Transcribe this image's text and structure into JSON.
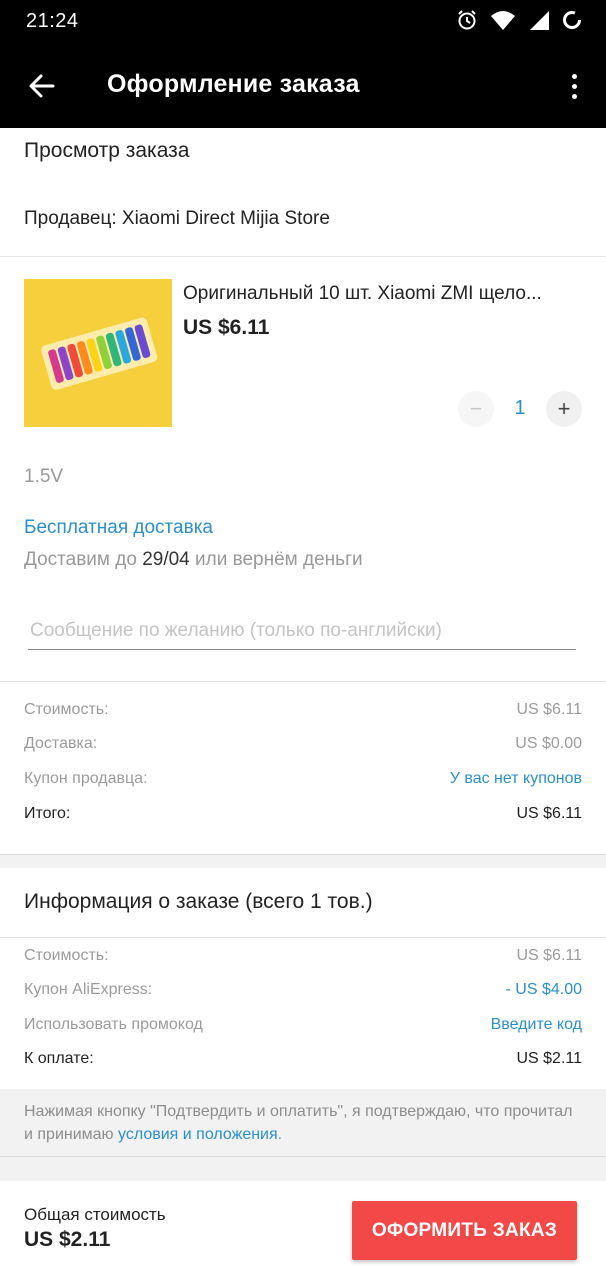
{
  "status_bar": {
    "time": "21:24",
    "icons": [
      "alarm-icon",
      "wifi-icon",
      "signal-icon",
      "battery-icon"
    ]
  },
  "app_bar": {
    "title": "Оформление заказа",
    "back_icon": "arrow-left-icon",
    "menu_icon": "more-vertical-icon"
  },
  "order_review": {
    "title": "Просмотр заказа",
    "seller": "Продавец: Xiaomi Direct Mijia Store"
  },
  "product": {
    "title": "Оригинальный 10 шт. Xiaomi ZMI щело...",
    "price": "US $6.11",
    "quantity": "1",
    "minus_symbol": "−",
    "plus_symbol": "+",
    "variant": "1.5V"
  },
  "shipping": {
    "free_label": "Бесплатная доставка",
    "deliver_prefix": "Доставим до ",
    "deliver_date": "29/04",
    "deliver_suffix": " или вернём деньги"
  },
  "message": {
    "placeholder": "Сообщение по желанию (только по-английски)",
    "value": ""
  },
  "seller_summary": {
    "rows": [
      {
        "label": "Стоимость:",
        "value": "US $6.11"
      },
      {
        "label": "Доставка:",
        "value": "US $0.00"
      },
      {
        "label": "Купон продавца:",
        "value": "У вас нет купонов"
      },
      {
        "label": "Итого:",
        "value": "US $6.11"
      }
    ]
  },
  "order_info": {
    "title": "Информация о заказе (всего 1 тов.)",
    "rows": [
      {
        "label": "Стоимость:",
        "value": "US $6.11"
      },
      {
        "label": "Купон AliExpress:",
        "value": "- US $4.00"
      },
      {
        "label": "Использовать промокод",
        "value": "Введите код"
      },
      {
        "label": "К оплате:",
        "value": "US $2.11"
      }
    ]
  },
  "terms": {
    "text": "Нажимая кнопку \"Подтвердить и оплатить\", я подтверждаю, что прочитал и принимаю ",
    "link": "условия и положения",
    "end": "."
  },
  "bottom": {
    "label": "Общая стоимость",
    "total": "US $2.11",
    "button": "ОФОРМИТЬ ЗАКАЗ"
  },
  "colors": {
    "accent_link": "#2b8fc9",
    "button_red": "#f24848",
    "app_bar": "#000000"
  }
}
